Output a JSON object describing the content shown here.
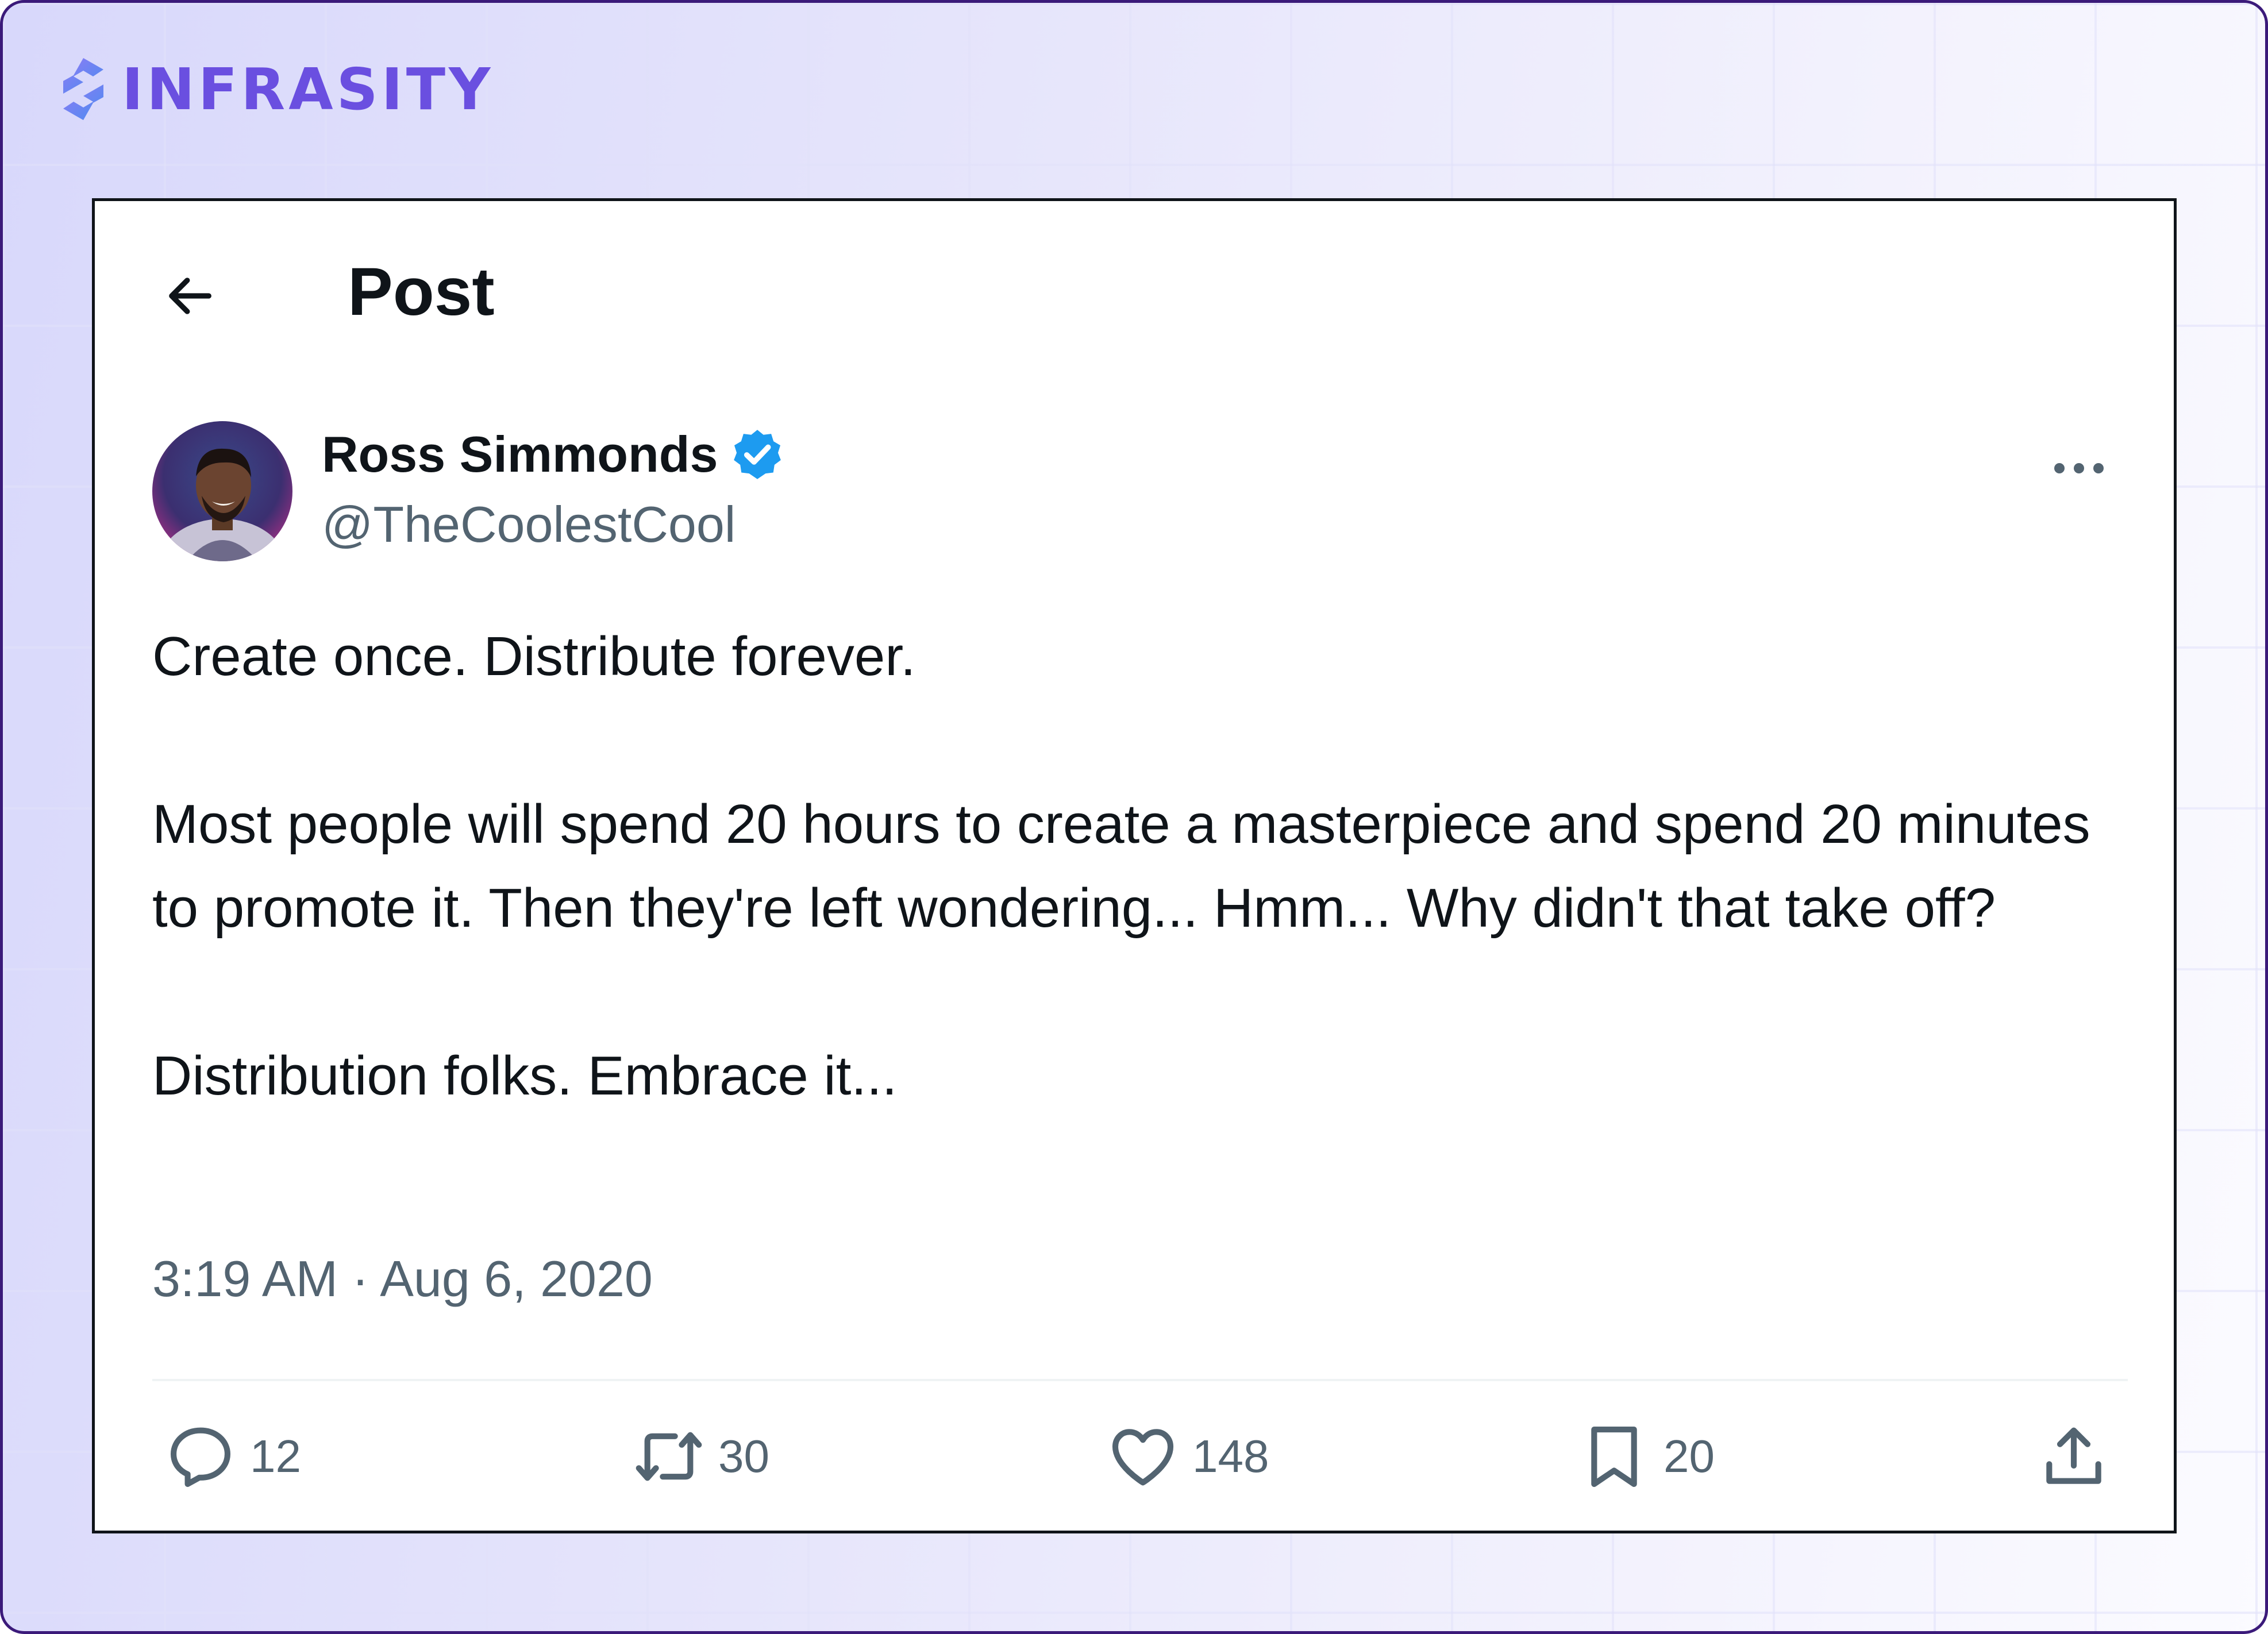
{
  "brand": {
    "name": "INFRASITY",
    "accent": "#6a4fe0"
  },
  "header": {
    "title": "Post"
  },
  "post": {
    "author": {
      "display_name": "Ross Simmonds",
      "handle": "@TheCoolestCool",
      "verified": true
    },
    "paragraphs": [
      "Create once. Distribute forever.",
      "Most people will spend 20 hours to create a masterpiece and spend 20 minutes to promote it. Then they're left wondering... Hmm... Why didn't that take off?",
      "Distribution folks. Embrace it..."
    ],
    "timestamp": "3:19 AM · Aug 6, 2020",
    "actions": {
      "replies": "12",
      "reposts": "30",
      "likes": "148",
      "bookmarks": "20"
    }
  },
  "colors": {
    "text": "#0f1419",
    "secondary_text": "#536471",
    "verified_badge": "#1d9bf0",
    "frame_border": "#3b1a7a"
  },
  "icons": {
    "back": "arrow-left-icon",
    "verified": "verified-badge-icon",
    "more": "more-horizontal-icon",
    "reply": "reply-icon",
    "repost": "repost-icon",
    "like": "heart-icon",
    "bookmark": "bookmark-icon",
    "share": "share-icon"
  }
}
